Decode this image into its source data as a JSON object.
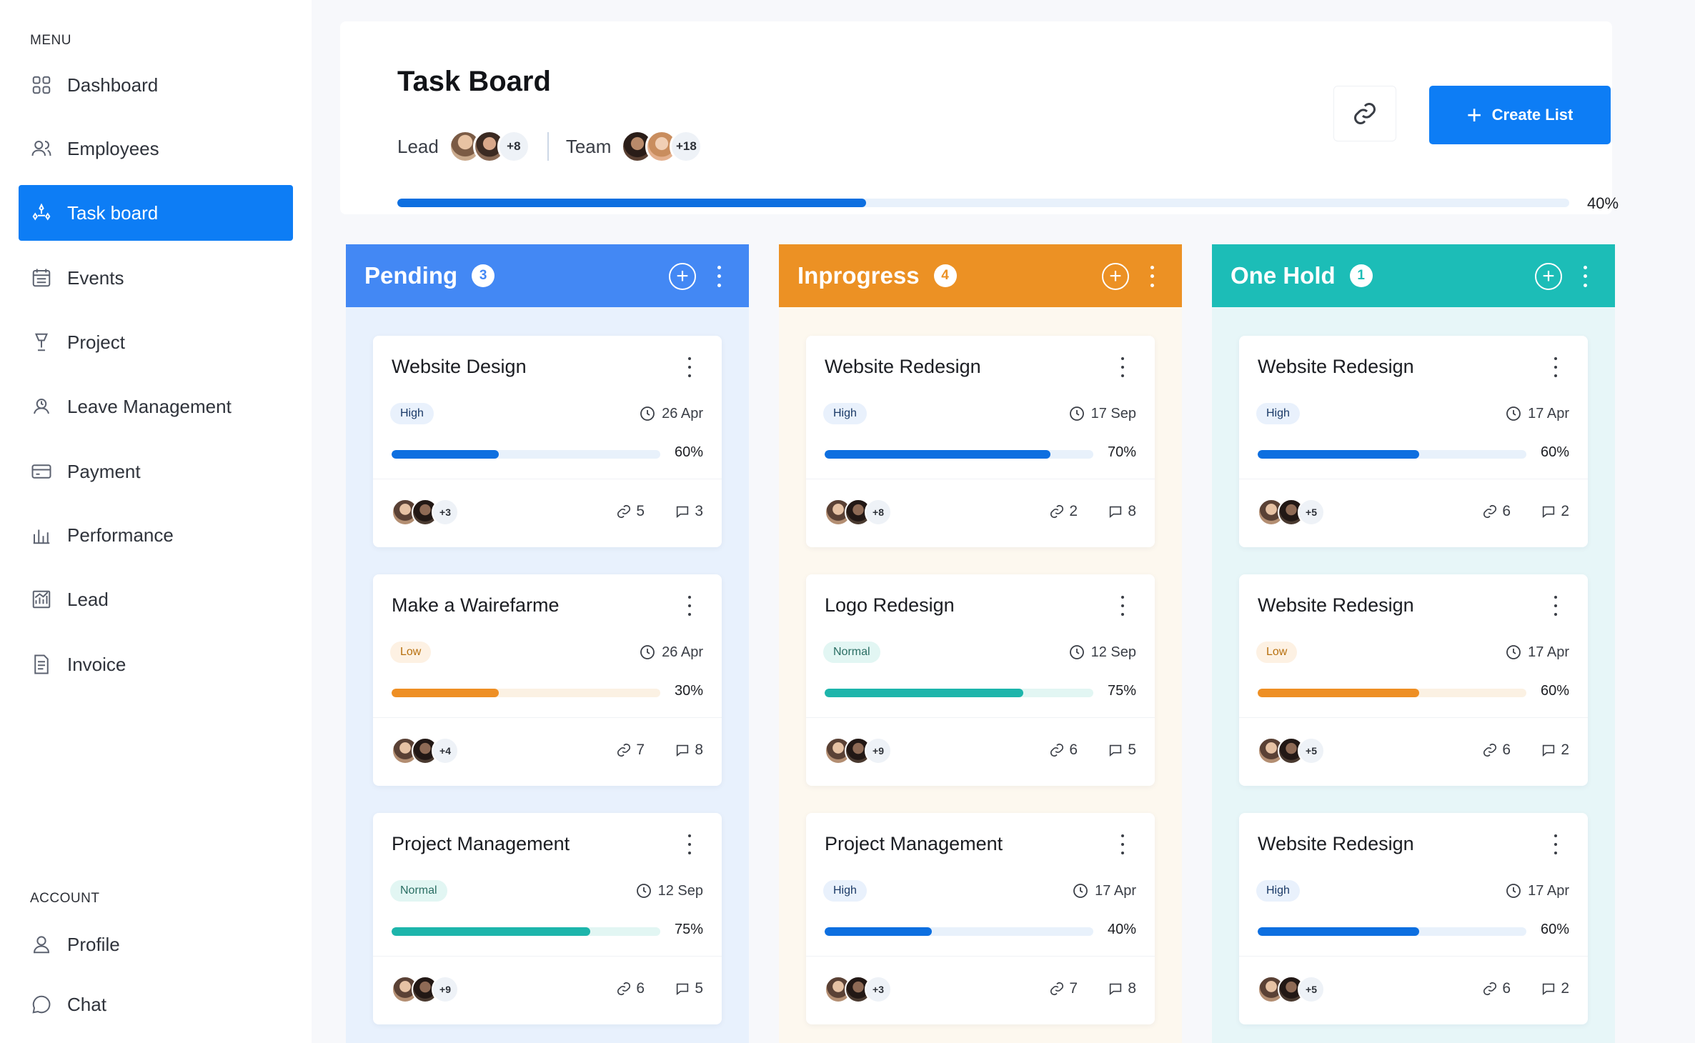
{
  "sidebar": {
    "menu_label": "MENU",
    "account_label": "ACCOUNT",
    "items": [
      {
        "label": "Dashboard",
        "icon": "grid-icon"
      },
      {
        "label": "Employees",
        "icon": "users-icon"
      },
      {
        "label": "Task board",
        "icon": "task-board-icon"
      },
      {
        "label": "Events",
        "icon": "calendar-icon"
      },
      {
        "label": "Project",
        "icon": "project-icon"
      },
      {
        "label": "Leave Management",
        "icon": "leave-icon"
      },
      {
        "label": "Payment",
        "icon": "card-icon"
      },
      {
        "label": "Performance",
        "icon": "performance-icon"
      },
      {
        "label": "Lead",
        "icon": "chart-icon"
      },
      {
        "label": "Invoice",
        "icon": "invoice-icon"
      }
    ],
    "account_items": [
      {
        "label": "Profile",
        "icon": "user-icon"
      },
      {
        "label": "Chat",
        "icon": "chat-icon"
      }
    ],
    "active_item": "Task board"
  },
  "header": {
    "title": "Task Board",
    "lead_label": "Lead",
    "lead_count": "+8",
    "team_label": "Team",
    "team_count": "+18",
    "create_label": "Create List",
    "progress_label": "40%",
    "progress": 0.4
  },
  "colors": {
    "accent": "#0d7df5",
    "pending": "#4388f4",
    "inprogress": "#ec9124",
    "onhold": "#1cbdb7",
    "high": "#0d6fe0",
    "low": "#ee8f24",
    "normal": "#1db5ab"
  },
  "columns": [
    {
      "title": "Pending",
      "count": "3",
      "tasks": [
        {
          "title": "Website Design",
          "priority": "High",
          "date": "26 Apr",
          "progress_label": "60%",
          "progress": 0.4,
          "members": "+3",
          "links": "5",
          "comments": "3"
        },
        {
          "title": "Make a Wairefarme",
          "priority": "Low",
          "date": "26 Apr",
          "progress_label": "30%",
          "progress": 0.4,
          "members": "+4",
          "links": "7",
          "comments": "8"
        },
        {
          "title": "Project Management",
          "priority": "Normal",
          "date": "12 Sep",
          "progress_label": "75%",
          "progress": 0.74,
          "members": "+9",
          "links": "6",
          "comments": "5"
        }
      ]
    },
    {
      "title": "Inprogress",
      "count": "4",
      "tasks": [
        {
          "title": "Website Redesign",
          "priority": "High",
          "date": "17 Sep",
          "progress_label": "70%",
          "progress": 0.84,
          "members": "+8",
          "links": "2",
          "comments": "8"
        },
        {
          "title": "Logo Redesign",
          "priority": "Normal",
          "date": "12 Sep",
          "progress_label": "75%",
          "progress": 0.74,
          "members": "+9",
          "links": "6",
          "comments": "5"
        },
        {
          "title": "Project Management",
          "priority": "High",
          "date": "17 Apr",
          "progress_label": "40%",
          "progress": 0.4,
          "members": "+3",
          "links": "7",
          "comments": "8"
        }
      ]
    },
    {
      "title": "One Hold",
      "count": "1",
      "tasks": [
        {
          "title": "Website Redesign",
          "priority": "High",
          "date": "17 Apr",
          "progress_label": "60%",
          "progress": 0.6,
          "members": "+5",
          "links": "6",
          "comments": "2"
        },
        {
          "title": "Website Redesign",
          "priority": "Low",
          "date": "17 Apr",
          "progress_label": "60%",
          "progress": 0.6,
          "members": "+5",
          "links": "6",
          "comments": "2"
        },
        {
          "title": "Website Redesign",
          "priority": "High",
          "date": "17 Apr",
          "progress_label": "60%",
          "progress": 0.6,
          "members": "+5",
          "links": "6",
          "comments": "2"
        }
      ]
    }
  ]
}
